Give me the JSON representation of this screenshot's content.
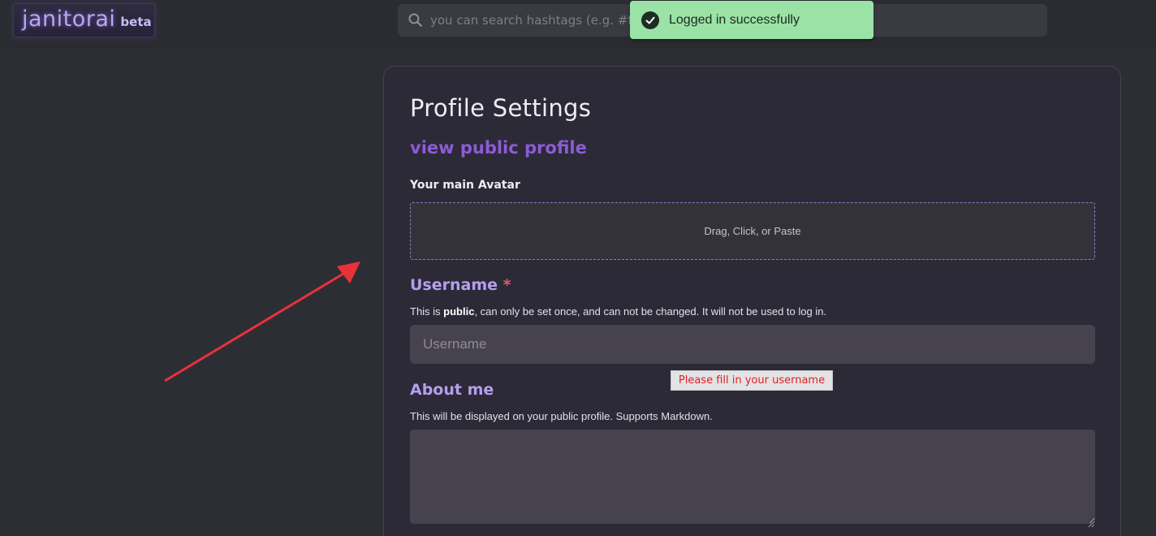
{
  "brand": {
    "name": "janitorai",
    "tag": "beta"
  },
  "search": {
    "placeholder": "you can search hashtags (e.g. #fant"
  },
  "toast": {
    "message": "Logged in successfully",
    "color": "#9be2a7"
  },
  "profile": {
    "title": "Profile Settings",
    "public_link": "view public profile",
    "avatar_label": "Your main Avatar",
    "dropzone_text": "Drag, Click, or Paste",
    "username": {
      "label": "Username",
      "required_mark": "*",
      "help_prefix": "This is ",
      "help_bold": "public",
      "help_suffix": ", can only be set once, and can not be changed. It will not be used to log in.",
      "placeholder": "Username",
      "value": "",
      "validation_message": "Please fill in your username"
    },
    "about": {
      "label": "About me",
      "help": "This will be displayed on your public profile. Supports Markdown.",
      "value": ""
    }
  },
  "colors": {
    "accent": "#8c5cd6",
    "label": "#b49ff0",
    "required": "#e35a6b",
    "annotation_arrow": "#e8323a"
  }
}
